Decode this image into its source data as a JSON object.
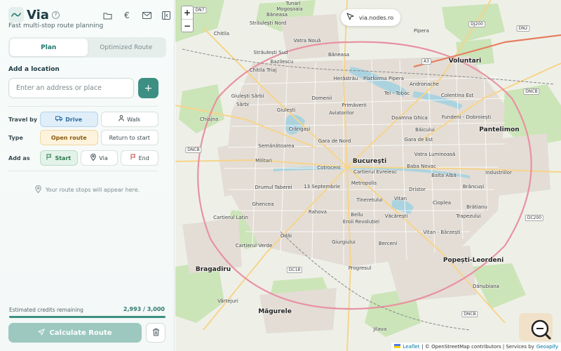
{
  "app": {
    "name": "Via",
    "help": "?",
    "tagline": "Fast multi-stop route planning",
    "header_icons": [
      "folder-icon",
      "euro-icon",
      "mail-icon",
      "collapse-panel-icon"
    ],
    "currency_symbol": "€"
  },
  "tabs": [
    {
      "label": "Plan",
      "active": true
    },
    {
      "label": "Optimized Route",
      "active": false
    }
  ],
  "add_location": {
    "title": "Add a location",
    "placeholder": "Enter an address or place",
    "add_symbol": "+"
  },
  "options": {
    "travel_by": {
      "label": "Travel by",
      "choices": [
        "Drive",
        "Walk"
      ],
      "selected": "Drive"
    },
    "type": {
      "label": "Type",
      "choices": [
        "Open route",
        "Return to start"
      ],
      "selected": "Open route"
    },
    "add_as": {
      "label": "Add as",
      "choices": [
        "Start",
        "Via",
        "End"
      ],
      "selected": "Start"
    }
  },
  "empty_state": "Your route stops will appear here.",
  "credits": {
    "label": "Estimated credits remaining",
    "value": "2,993 / 3,000",
    "fraction": 0.998
  },
  "calculate_label": "Calculate Route",
  "map": {
    "zoom_in": "+",
    "zoom_out": "−",
    "site": "via.nodes.ro",
    "labels": {
      "l1": "Mogoșoaia",
      "l2": "Tunari",
      "l3": "Băneasa",
      "l4": "Străulești Nord",
      "l5": "Chitila",
      "l6": "Vatra Nouă",
      "l7": "Străulești Sud",
      "l8": "Băneasa",
      "l9": "Bazilescu",
      "l10": "Chitila Triaj",
      "l11": "Herăstrău",
      "l12": "Platforma Pipera",
      "l13": "Voluntari",
      "l14": "Giulești Sârbi",
      "l15": "Domenii",
      "l16": "Andronache",
      "l17": "Tei - Tobac",
      "l18": "Colentina Est",
      "l19": "Giulești",
      "l20": "Primăverii",
      "l21": "Aviatorilor",
      "l22": "Chiajna",
      "l23": "Crângași",
      "l24": "Doamna Ghica",
      "l25": "Fundeni - Dobroiești",
      "l26": "Pantelimon",
      "l27": "Gara de Nord",
      "l28": "Băicului",
      "l29": "Gara de Est",
      "l30": "Semănătoarea",
      "l31": "Vatra Luminoasă",
      "l32": "Militari",
      "l33": "București",
      "l34": "Cotroceni",
      "l35": "Cartierul Evreiesc",
      "l36": "Baba Novac",
      "l37": "Balta Albă",
      "l38": "Industriilor",
      "l39": "Drumul Taberei",
      "l40": "13 Septembrie",
      "l41": "Metropolis",
      "l42": "Dristor",
      "l43": "Brâncuși",
      "l44": "Ghencea",
      "l45": "Tineretului",
      "l46": "Vitan",
      "l47": "Cioplea",
      "l48": "Cartierul Latin",
      "l49": "Rahova",
      "l50": "Bellu",
      "l51": "Văcărești",
      "l52": "Trapezului",
      "l53": "Eroii Revoluției",
      "l54": "Odăi",
      "l55": "Giurgiului",
      "l56": "Cartierul Verde",
      "l57": "Berceni",
      "l58": "Vitan - Bârzești",
      "l59": "Bragadiru",
      "l60": "Popești-Leordeni",
      "l61": "Progresul",
      "l62": "Vârtejuri",
      "l63": "Dănubiana",
      "l64": "Măgurele",
      "l65": "Pipera",
      "l66": "Sârbi",
      "l67": "Jilava",
      "l68": "Brătianu"
    },
    "shields": {
      "s1": "DN7",
      "s2": "DJ200",
      "s3": "DN2",
      "s4": "A3",
      "s5": "DNCB",
      "s6": "DNCB",
      "s7": "DC200",
      "s8": "DC18",
      "s9": "DNCB"
    },
    "attribution": {
      "leaflet": "Leaflet",
      "text": "| © OpenStreetMap contributors | Services by",
      "provider": "Geoapify"
    }
  },
  "colors": {
    "accent": "#3c8f82",
    "accent_light": "#9cc8bf",
    "drive": "#dfeef9",
    "open_route": "#fdf3dc",
    "start": "#e3f3ea"
  }
}
